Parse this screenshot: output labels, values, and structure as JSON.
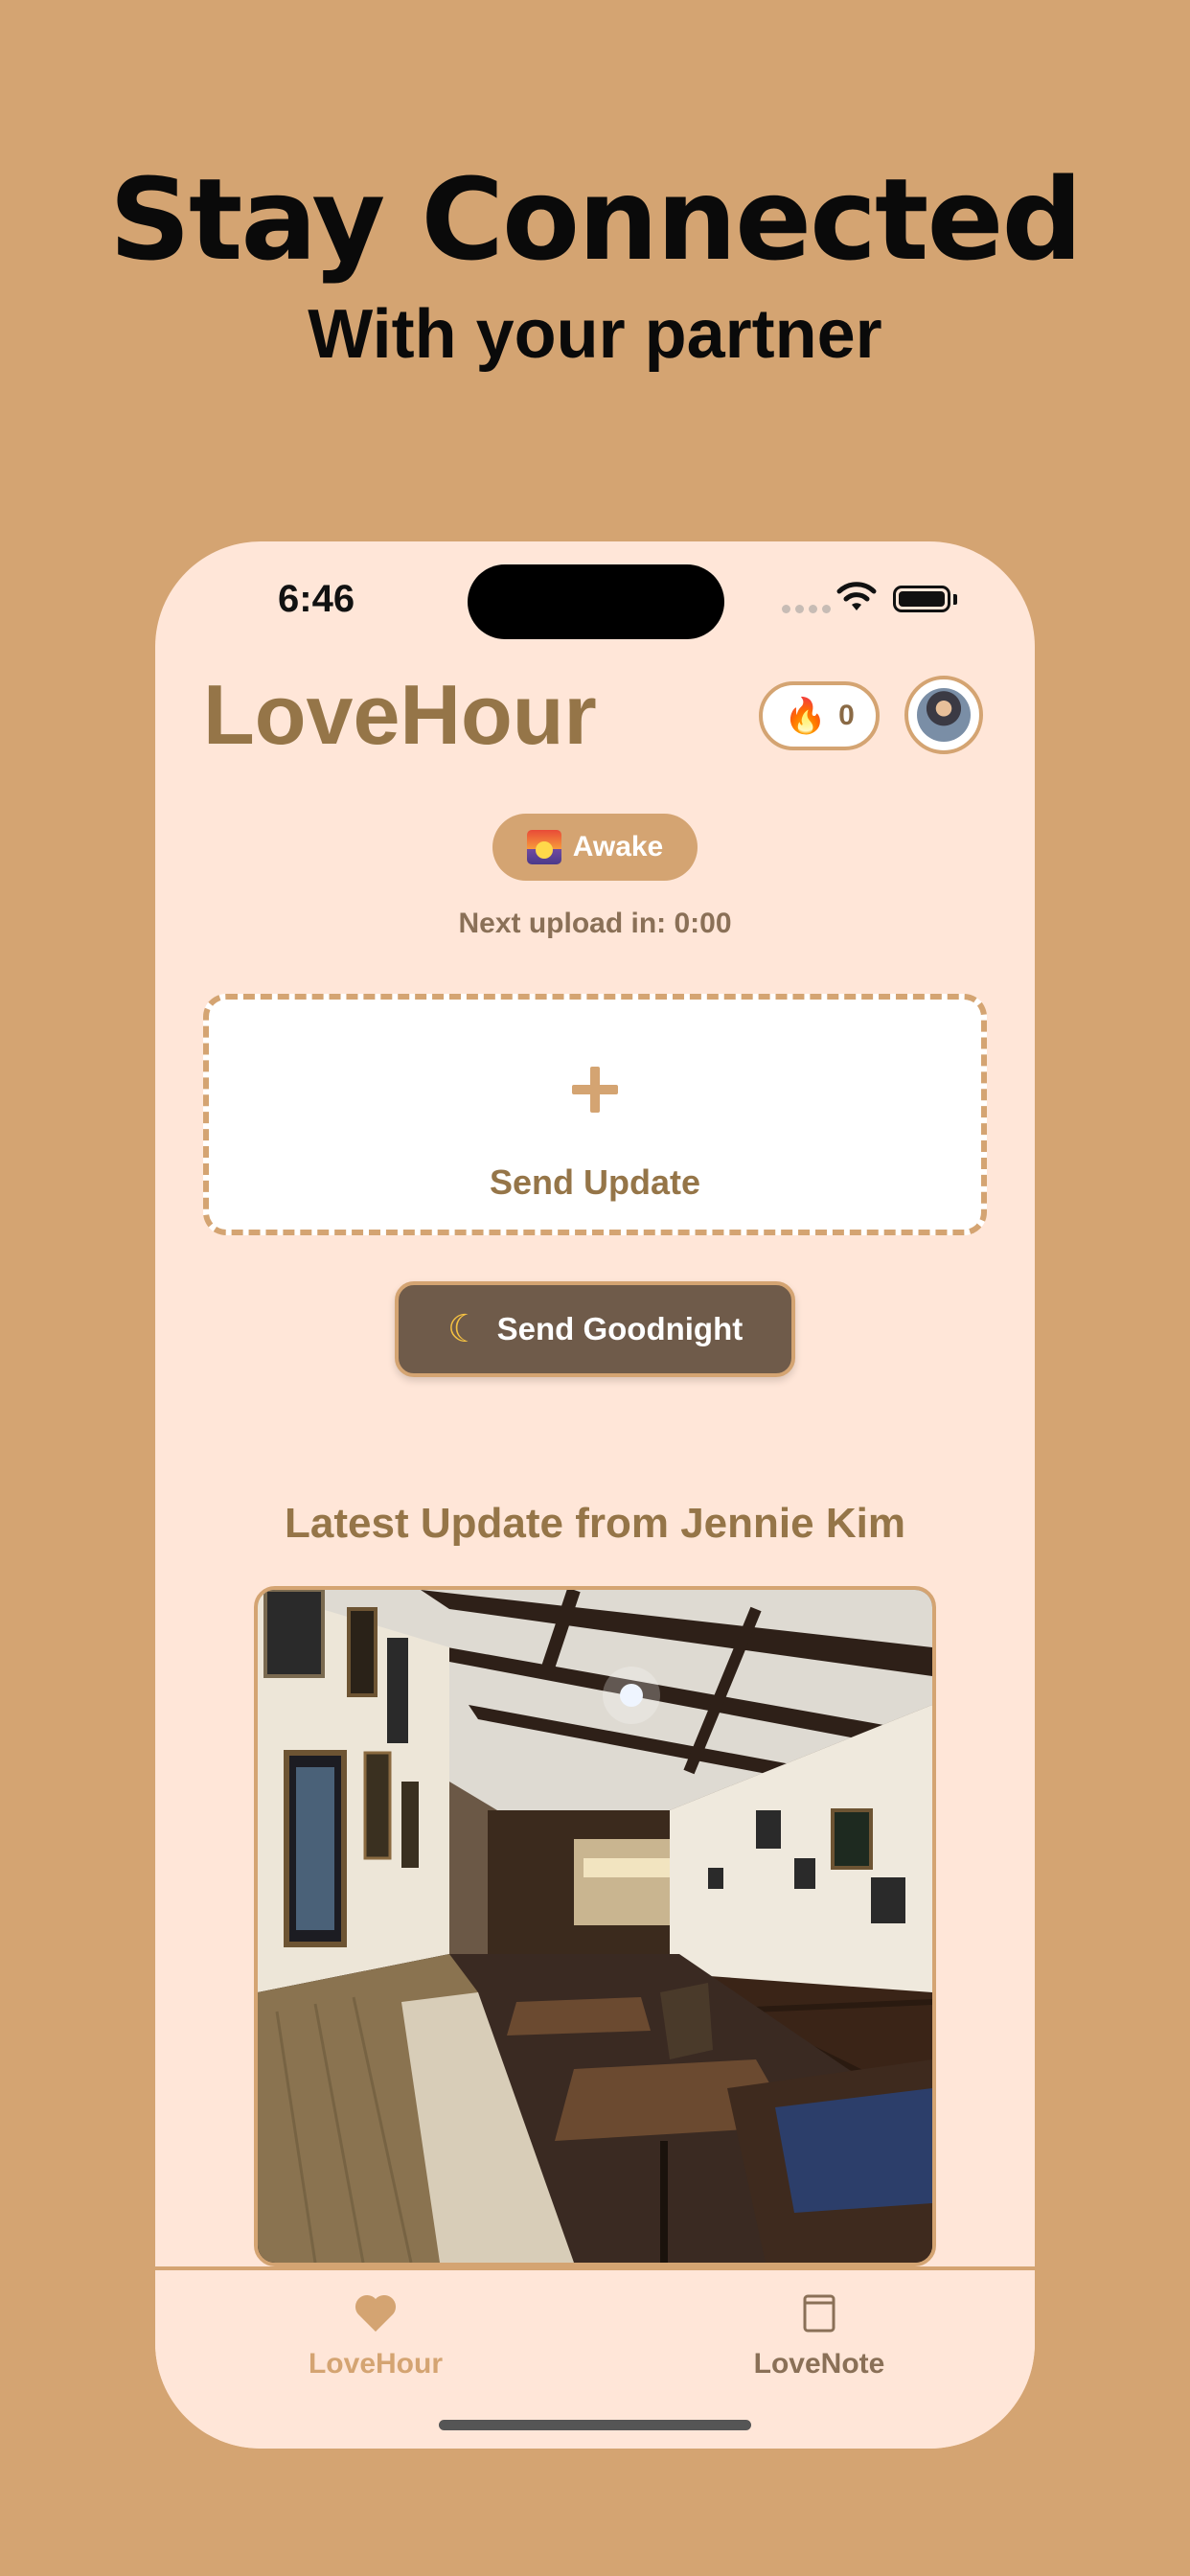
{
  "marketing": {
    "headline": "Stay Connected",
    "subheadline": "With your partner"
  },
  "status_bar": {
    "time": "6:46"
  },
  "header": {
    "app_title": "LoveHour",
    "streak_icon": "flame-icon",
    "streak_count": "0",
    "avatar_icon": "profile-avatar"
  },
  "status": {
    "icon": "sunrise-icon",
    "label": "Awake"
  },
  "next_upload": "Next upload in: 0:00",
  "upload_card": {
    "icon": "plus-icon",
    "label": "Send Update"
  },
  "goodnight": {
    "icon": "crescent-moon-icon",
    "label": "Send Goodnight"
  },
  "latest": {
    "title": "Latest Update from Jennie Kim"
  },
  "tabs": [
    {
      "icon": "heart-icon",
      "label": "LoveHour",
      "active": true
    },
    {
      "icon": "note-icon",
      "label": "LoveNote",
      "active": false
    }
  ],
  "colors": {
    "background": "#D4A472",
    "phone_surface": "#FFE6D8",
    "accent": "#D4A472",
    "title_brown": "#957548",
    "button_dark": "#6F5B4A"
  }
}
